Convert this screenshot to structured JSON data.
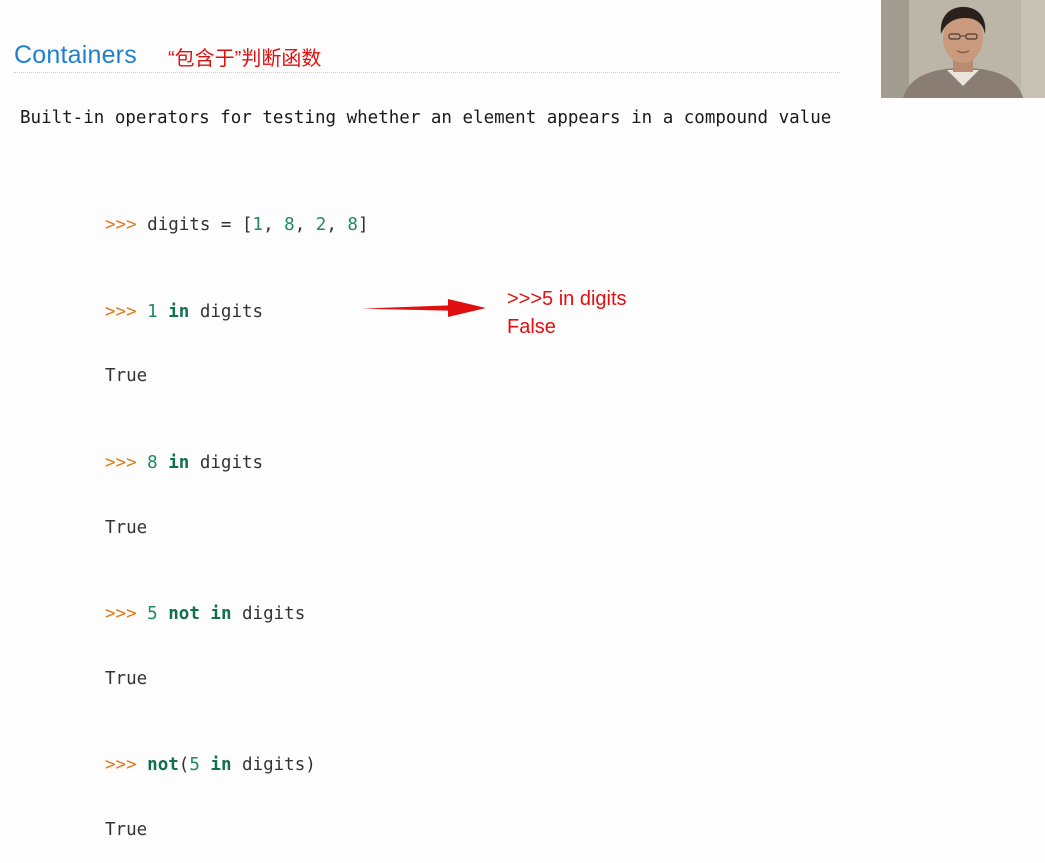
{
  "slide": {
    "title": "Containers",
    "annotation": "“包含于”判断函数",
    "subtitle": "Built-in operators for testing whether an element appears in a compound value"
  },
  "code": {
    "prompt": ">>>",
    "line1": {
      "var": "digits",
      "eq": " = [",
      "n1": "1",
      "sep1": ", ",
      "n2": "8",
      "sep2": ", ",
      "n3": "2",
      "sep3": ", ",
      "n4": "8",
      "close": "]"
    },
    "line2": {
      "num": "1",
      "kw": "in",
      "rest": " digits"
    },
    "out2": "True",
    "line3": {
      "num": "8",
      "kw": "in",
      "rest": " digits"
    },
    "out3": "True",
    "line4": {
      "num": "5",
      "kw1": "not",
      "kw2": "in",
      "rest": " digits"
    },
    "out4": "True",
    "line5": {
      "kw": "not",
      "open": "(",
      "num": "5",
      "kw2": "in",
      "rest": " digits)"
    },
    "out5": "True"
  },
  "note": {
    "line1": ">>>5 in digits",
    "line2": "False",
    "color": "#e01010"
  },
  "colors": {
    "title": "#1f7fd0",
    "prompt": "#e07b1a",
    "keyword": "#12704e",
    "number": "#1f8a5c"
  }
}
